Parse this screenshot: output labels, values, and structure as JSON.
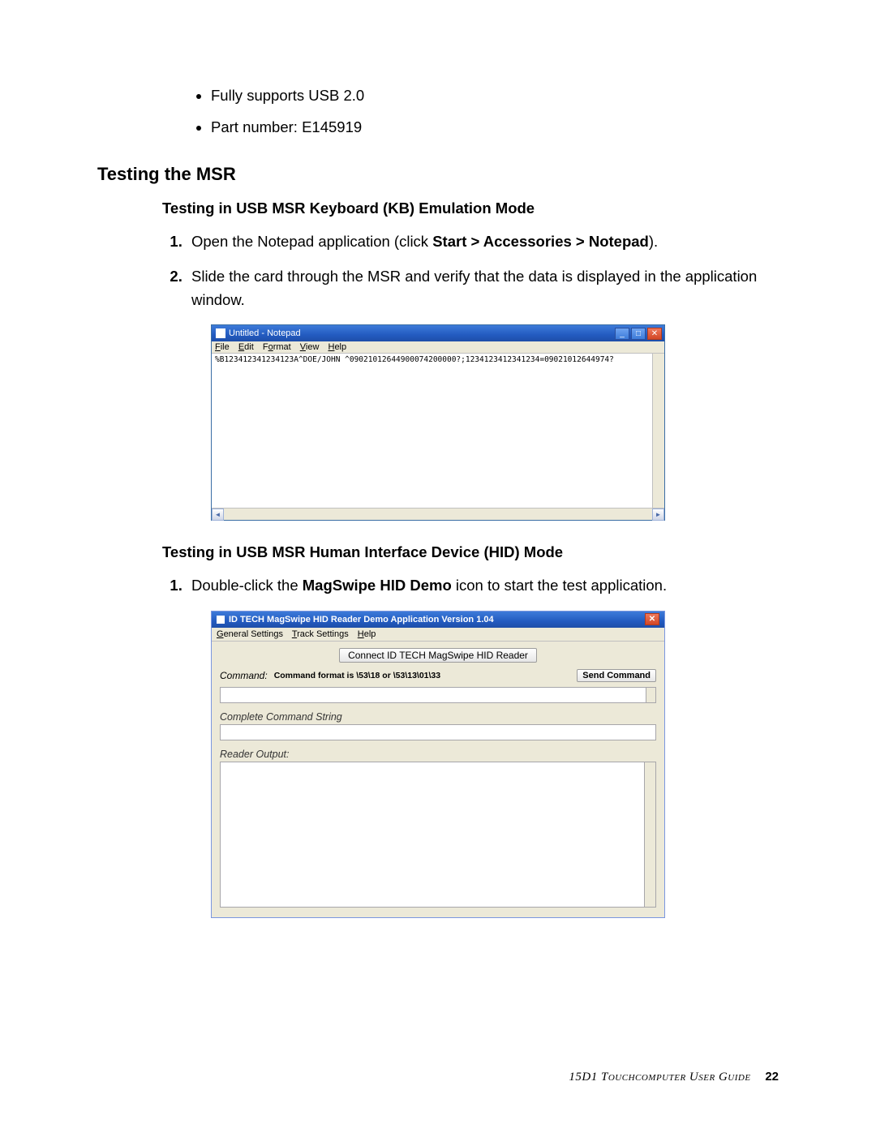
{
  "bullets": {
    "b1": "Fully supports USB 2.0",
    "b2": "Part number: E145919"
  },
  "section_heading": "Testing the MSR",
  "sub1_heading": "Testing in USB MSR Keyboard (KB) Emulation Mode",
  "step_kb_1_pre": "Open the Notepad application (click ",
  "step_kb_1_bold": "Start > Accessories > Notepad",
  "step_kb_1_post": ").",
  "step_kb_2": "Slide the card through the MSR and verify that the data is displayed in the application window.",
  "notepad": {
    "title": "Untitled - Notepad",
    "menu_file": "File",
    "menu_edit": "Edit",
    "menu_format": "Format",
    "menu_view": "View",
    "menu_help": "Help",
    "content": "%B123412341234123A^DOE/JOHN ^09021012644900074200000?;1234123412341234=09021012644974?"
  },
  "sub2_heading": "Testing in USB MSR Human Interface Device (HID) Mode",
  "step_hid_1_pre": "Double-click the ",
  "step_hid_1_bold": "MagSwipe HID Demo",
  "step_hid_1_post": " icon to start the test application.",
  "hid": {
    "title": "ID TECH MagSwipe HID Reader Demo Application Version 1.04",
    "menu_general": "General Settings",
    "menu_track": "Track Settings",
    "menu_help": "Help",
    "connect_btn": "Connect ID TECH MagSwipe HID Reader",
    "command_label": "Command:",
    "command_hint": "Command format is \\53\\18 or \\53\\13\\01\\33",
    "send_btn": "Send Command",
    "complete_label": "Complete Command String",
    "output_label": "Reader Output:"
  },
  "footer": {
    "book": "15D1 Touchcomputer User Guide",
    "page": "22"
  }
}
